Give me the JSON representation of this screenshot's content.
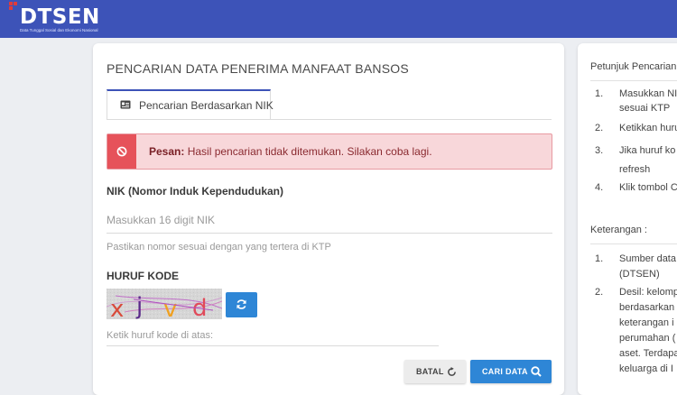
{
  "header": {
    "logo_text": "DTSEN",
    "logo_subtitle": "Data Tunggal Sosial dan Ekonomi Nasional",
    "brand_color": "#3d53b8"
  },
  "main": {
    "title": "PENCARIAN DATA PENERIMA MANFAAT BANSOS",
    "tab_label": "Pencarian Berdasarkan NIK",
    "alert": {
      "prefix": "Pesan:",
      "message": "Hasil pencarian tidak ditemukan. Silakan coba lagi.",
      "color": "#e6525a"
    },
    "nik": {
      "label": "NIK (Nomor Induk Kependudukan)",
      "value": "",
      "placeholder": "Masukkan 16 digit NIK",
      "help": "Pastikan nomor sesuai dengan yang tertera di KTP"
    },
    "kode": {
      "label": "HURUF KODE",
      "captcha_text": [
        "x",
        "j",
        "v",
        "d"
      ],
      "value": "",
      "placeholder": "Ketik huruf kode di atas:"
    },
    "buttons": {
      "batal": "BATAL",
      "cari": "CARI DATA",
      "accent": "#2e86d6"
    }
  },
  "sidebar": {
    "petunjuk_title": "Petunjuk Pencarian",
    "petunjuk_items": [
      {
        "num": "1.",
        "lines": [
          "Masukkan NI",
          "sesuai KTP"
        ]
      },
      {
        "num": "2.",
        "lines": [
          "Ketikkan huru"
        ]
      },
      {
        "num": "3.",
        "lines": [
          "Jika huruf ko",
          "refresh"
        ]
      },
      {
        "num": "4.",
        "lines": [
          "Klik tombol C"
        ]
      }
    ],
    "keterangan_title": "Keterangan :",
    "keterangan_items": [
      {
        "num": "1.",
        "lines": [
          "Sumber data",
          "(DTSEN)"
        ]
      },
      {
        "num": "2.",
        "lines": [
          "Desil: kelomp",
          "berdasarkan",
          "keterangan i",
          "perumahan (",
          "aset. Terdapa",
          "keluarga di I"
        ]
      }
    ]
  }
}
